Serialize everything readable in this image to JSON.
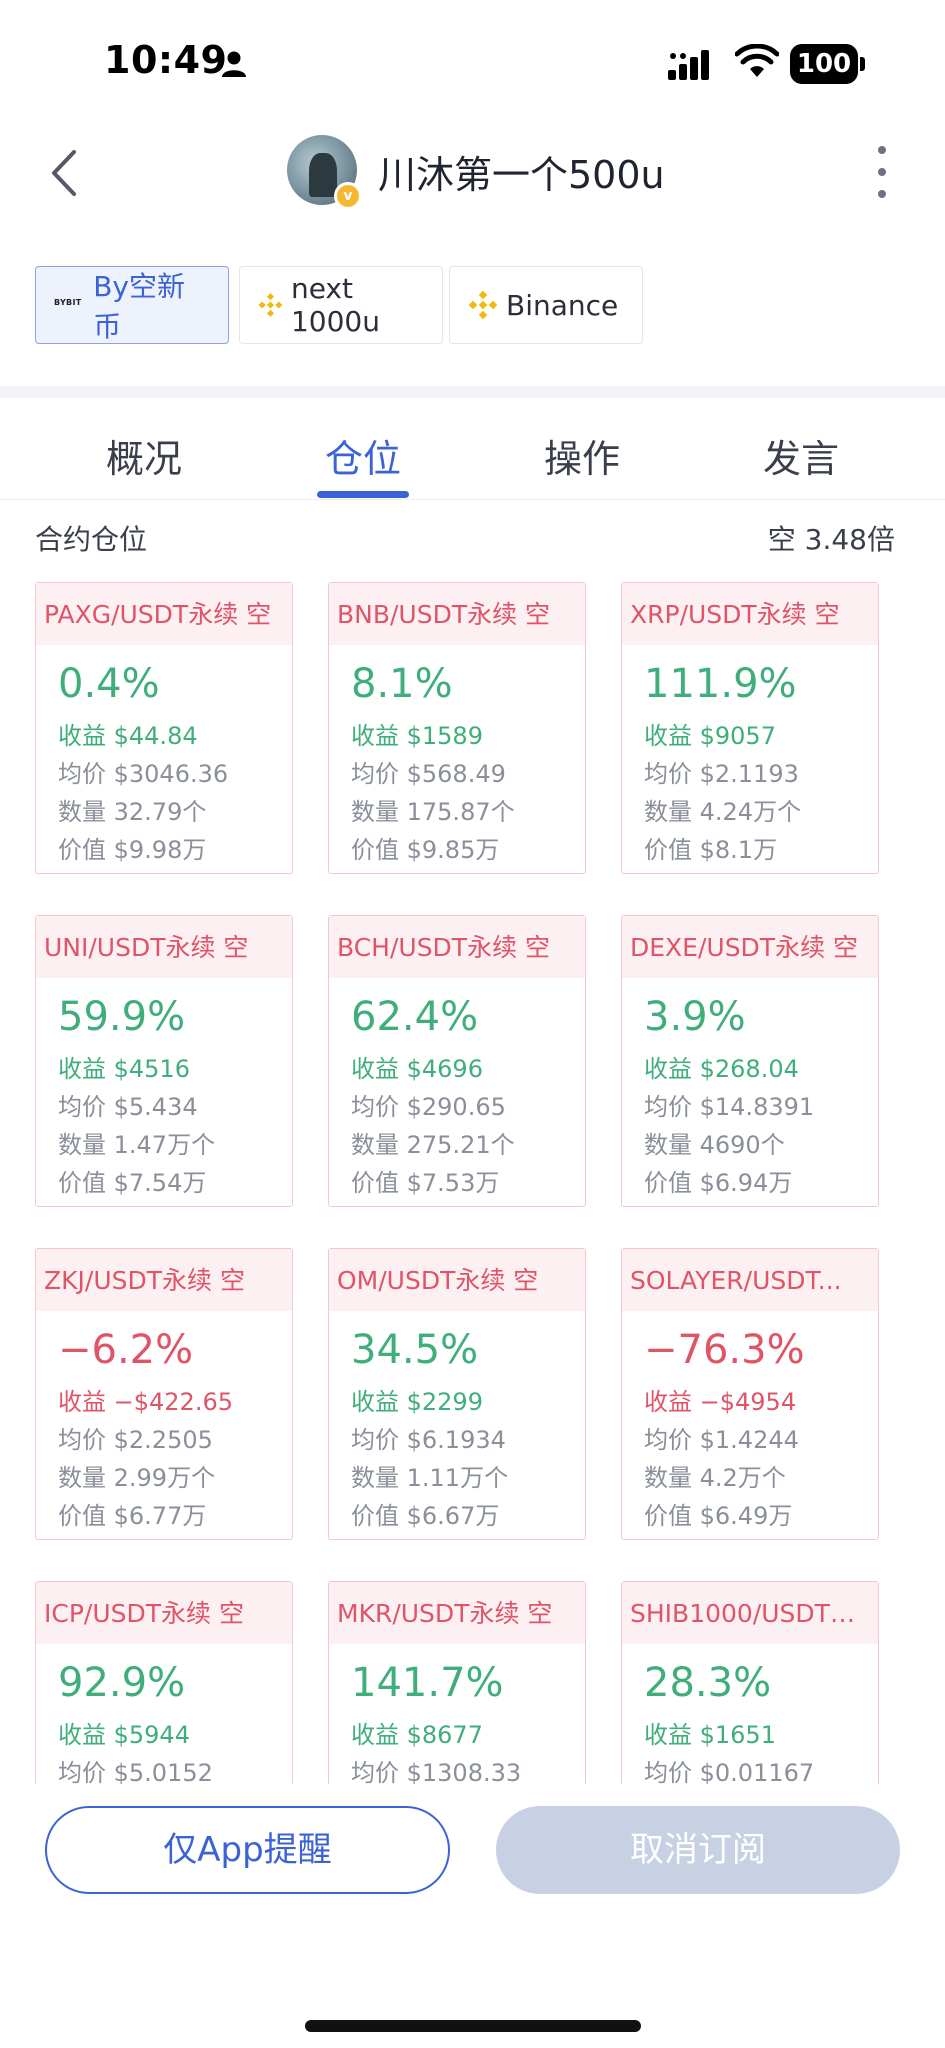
{
  "status_bar": {
    "time": "10:49",
    "battery": "100"
  },
  "header": {
    "title": "川沐第一个500u",
    "verified_mark": "v"
  },
  "accounts": [
    {
      "label": "By空新币",
      "logo": "BYBIT",
      "active": true
    },
    {
      "label": "next 1000u",
      "logo": "binance-icon",
      "active": false
    },
    {
      "label": "Binance",
      "logo": "binance-icon",
      "active": false
    }
  ],
  "tabs": [
    {
      "label": "概况"
    },
    {
      "label": "仓位"
    },
    {
      "label": "操作"
    },
    {
      "label": "发言"
    }
  ],
  "active_tab": "仓位",
  "section": {
    "title": "合约仓位",
    "summary": "空 3.48倍"
  },
  "positions": [
    {
      "name": "PAXG/USDT永续 空",
      "pct": "0.4%",
      "pnl": "收益 $44.84",
      "avg": "均价 $3046.36",
      "qty": "数量 32.79个",
      "value": "价值 $9.98万",
      "positive": true
    },
    {
      "name": "BNB/USDT永续 空",
      "pct": "8.1%",
      "pnl": "收益 $1589",
      "avg": "均价 $568.49",
      "qty": "数量 175.87个",
      "value": "价值 $9.85万",
      "positive": true
    },
    {
      "name": "XRP/USDT永续 空",
      "pct": "111.9%",
      "pnl": "收益 $9057",
      "avg": "均价 $2.1193",
      "qty": "数量 4.24万个",
      "value": "价值 $8.1万",
      "positive": true
    },
    {
      "name": "UNI/USDT永续 空",
      "pct": "59.9%",
      "pnl": "收益 $4516",
      "avg": "均价 $5.434",
      "qty": "数量 1.47万个",
      "value": "价值 $7.54万",
      "positive": true
    },
    {
      "name": "BCH/USDT永续 空",
      "pct": "62.4%",
      "pnl": "收益 $4696",
      "avg": "均价 $290.65",
      "qty": "数量 275.21个",
      "value": "价值 $7.53万",
      "positive": true
    },
    {
      "name": "DEXE/USDT永续 空",
      "pct": "3.9%",
      "pnl": "收益 $268.04",
      "avg": "均价 $14.8391",
      "qty": "数量 4690个",
      "value": "价值 $6.94万",
      "positive": true
    },
    {
      "name": "ZKJ/USDT永续 空",
      "pct": "−6.2%",
      "pnl": "收益 −$422.65",
      "avg": "均价 $2.2505",
      "qty": "数量 2.99万个",
      "value": "价值 $6.77万",
      "positive": false
    },
    {
      "name": "OM/USDT永续 空",
      "pct": "34.5%",
      "pnl": "收益 $2299",
      "avg": "均价 $6.1934",
      "qty": "数量 1.11万个",
      "value": "价值 $6.67万",
      "positive": true
    },
    {
      "name": "SOLAYER/USDT...",
      "pct": "−76.3%",
      "pnl": "收益 −$4954",
      "avg": "均价 $1.4244",
      "qty": "数量 4.2万个",
      "value": "价值 $6.49万",
      "positive": false
    },
    {
      "name": "ICP/USDT永续 空",
      "pct": "92.9%",
      "pnl": "收益 $5944",
      "avg": "均价 $5.0152",
      "qty": "",
      "value": "",
      "positive": true
    },
    {
      "name": "MKR/USDT永续 空",
      "pct": "141.7%",
      "pnl": "收益 $8677",
      "avg": "均价 $1308.33",
      "qty": "",
      "value": "",
      "positive": true
    },
    {
      "name": "SHIB1000/USDT永...",
      "pct": "28.3%",
      "pnl": "收益 $1651",
      "avg": "均价 $0.01167",
      "qty": "",
      "value": "",
      "positive": true
    }
  ],
  "buttons": {
    "app_only": "仅App提醒",
    "unsubscribe": "取消订阅"
  },
  "colors": {
    "accent": "#3c63d6",
    "profit": "#3fae7a",
    "loss": "#e05468"
  }
}
